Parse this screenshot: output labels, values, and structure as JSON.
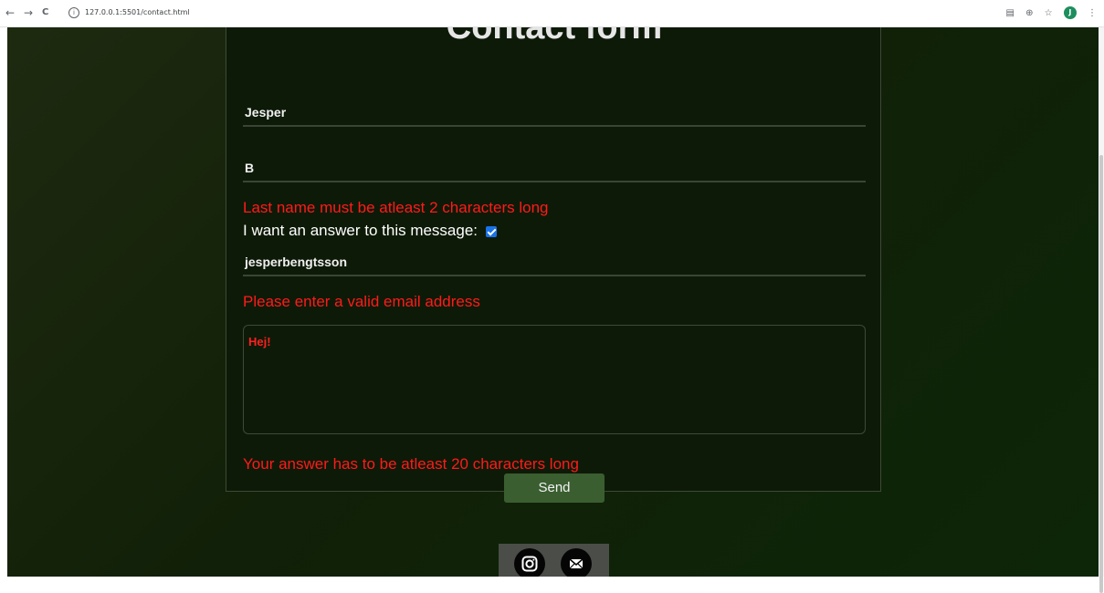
{
  "browser": {
    "back_icon": "←",
    "forward_icon": "→",
    "reload_icon": "C",
    "url": "127.0.0.1:5501/contact.html",
    "avatar_letter": "J"
  },
  "form": {
    "title": "Contact form",
    "first_name_value": "Jesper",
    "last_name_value": "B",
    "last_name_error": "Last name must be atleast 2 characters long",
    "answer_label": "I want an answer to this message:",
    "answer_checked": true,
    "email_value": "jesperbengtsson",
    "email_error": "Please enter a valid email address",
    "message_value": "Hej!",
    "message_error": "Your answer has to be atleast 20 characters long",
    "send_label": "Send"
  },
  "colors": {
    "error": "#ff1a1a",
    "button": "#3a5e30",
    "checkbox": "#1a73e8"
  },
  "footer": {
    "icons": [
      "instagram-icon",
      "mail-icon"
    ]
  }
}
